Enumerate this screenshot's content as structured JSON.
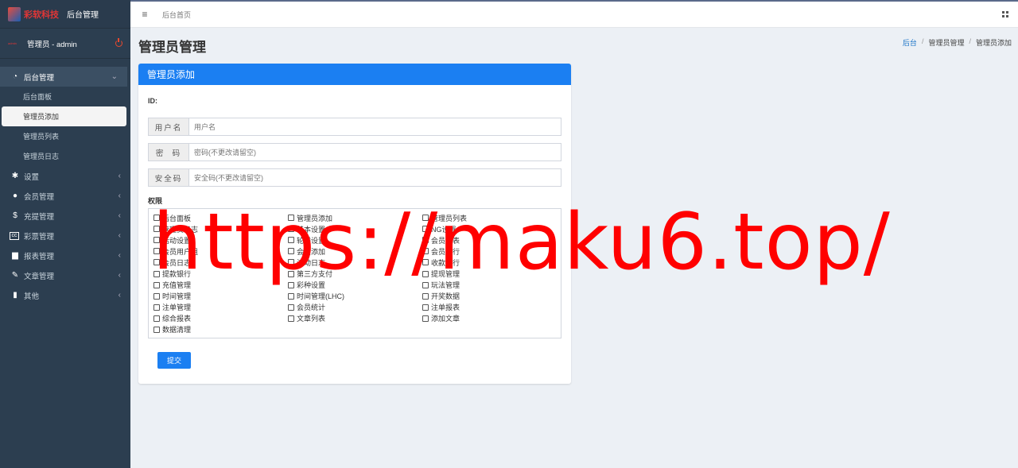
{
  "sidebar": {
    "logo_text": "彩软科技",
    "title": "后台管理",
    "user": {
      "avatar_text": "admin",
      "name": "管理员 - admin"
    },
    "menu": [
      {
        "label": "后台管理",
        "icon": "dashboard-icon",
        "expanded": true,
        "children": [
          "后台面板",
          "管理员添加",
          "管理员列表",
          "管理员日志"
        ],
        "active_child": 1
      },
      {
        "label": "设置",
        "icon": "gear-icon"
      },
      {
        "label": "会员管理",
        "icon": "user-icon"
      },
      {
        "label": "充提管理",
        "icon": "dollar-icon"
      },
      {
        "label": "彩票管理",
        "icon": "cc-icon"
      },
      {
        "label": "报表管理",
        "icon": "file-icon"
      },
      {
        "label": "文章管理",
        "icon": "edit-icon"
      },
      {
        "label": "其他",
        "icon": "trash-icon"
      }
    ]
  },
  "header": {
    "crumb": "后台首页"
  },
  "page": {
    "title": "管理员管理",
    "breadcrumb": {
      "home": "后台",
      "section": "管理员管理",
      "current": "管理员添加"
    }
  },
  "form": {
    "panel_title": "管理员添加",
    "id_label": "ID:",
    "username": {
      "label": "用户名",
      "placeholder": "用户名"
    },
    "password": {
      "label": "密  码",
      "placeholder": "密码(不更改请留空)"
    },
    "safecode": {
      "label": "安全码",
      "placeholder": "安全码(不更改请留空)"
    },
    "perm_label": "权限",
    "permissions": [
      "后台面板",
      "管理员添加",
      "管理员列表",
      "管理员日志",
      "基本设置",
      "NG设置",
      "活动设置",
      "轮播设置",
      "会员列表",
      "会员用户组",
      "会员添加",
      "会员银行",
      "会员日志",
      "活动日志",
      "收款银行",
      "提款银行",
      "第三方支付",
      "提现管理",
      "充值管理",
      "彩种设置",
      "玩法管理",
      "时间管理",
      "时间管理(LHC)",
      "开奖数据",
      "注单管理",
      "会员统计",
      "注单报表",
      "综合报表",
      "文章列表",
      "添加文章",
      "数据清理"
    ],
    "submit_label": "提交"
  },
  "watermark": "https://maku6.top/",
  "colors": {
    "sidebar": "#2c3e50",
    "primary": "#1b7ff2",
    "watermark": "#ff0000"
  }
}
